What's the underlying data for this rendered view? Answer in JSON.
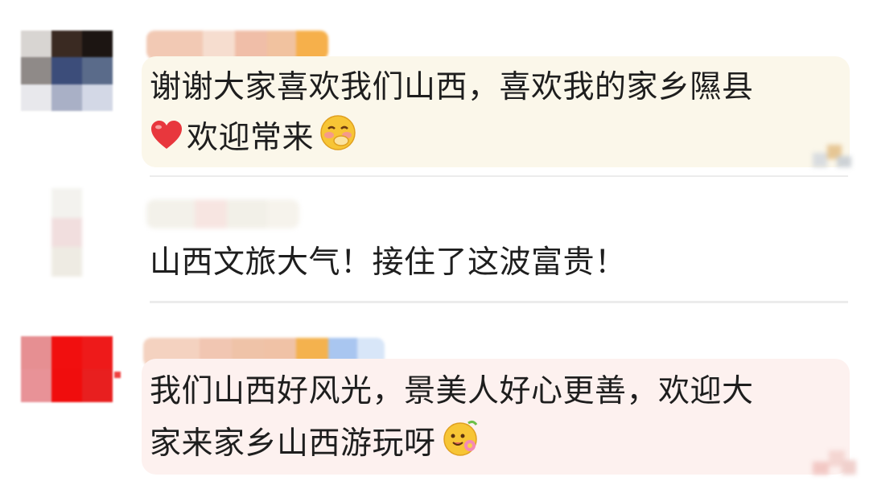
{
  "comments": [
    {
      "lines": [
        "谢谢大家喜欢我们山西，喜欢我的家乡隰县",
        "欢迎常来"
      ],
      "icons": [
        "red-heart-icon",
        "blushing-face-emoji-icon"
      ]
    },
    {
      "lines": [
        "山西文旅大气！接住了这波富贵！"
      ],
      "icons": []
    },
    {
      "lines": [
        "我们山西好风光，景美人好心更善，欢迎大",
        "家来家乡山西游玩呀"
      ],
      "icons": [
        "flower-face-emoji-icon"
      ]
    }
  ],
  "colors": {
    "heart": "#e8373d",
    "emoji_yellow": "#f7c535",
    "bubble_1": "#fbf7ea",
    "bubble_3": "#fdf1ef",
    "divider": "#ececec"
  }
}
